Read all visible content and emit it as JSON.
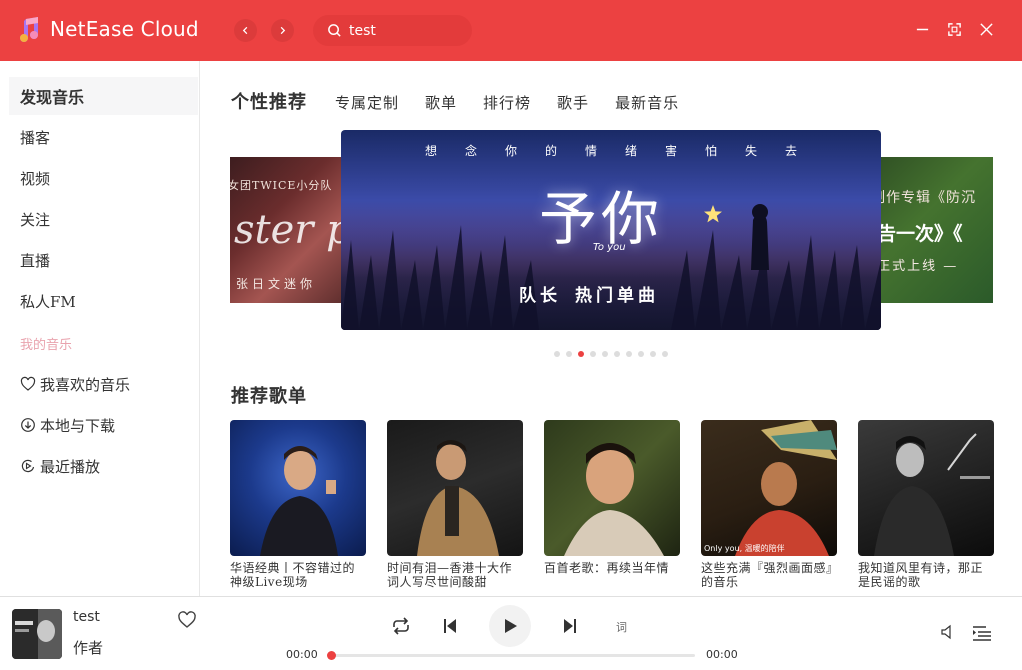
{
  "app": {
    "title": "NetEase Cloud",
    "brand_color": "#ec4141"
  },
  "search": {
    "value": "test"
  },
  "sidebar": {
    "items": [
      {
        "label": "发现音乐"
      },
      {
        "label": "播客"
      },
      {
        "label": "视频"
      },
      {
        "label": "关注"
      },
      {
        "label": "直播"
      },
      {
        "label": "私人FM"
      }
    ],
    "my_music_title": "我的音乐",
    "my_music": [
      {
        "label": "我喜欢的音乐",
        "icon": "heart-icon"
      },
      {
        "label": "本地与下载",
        "icon": "download-icon"
      },
      {
        "label": "最近播放",
        "icon": "recent-play-icon"
      }
    ]
  },
  "tabs": [
    "个性推荐",
    "专属定制",
    "歌单",
    "排行榜",
    "歌手",
    "最新音乐"
  ],
  "banner": {
    "left": {
      "top": "女团TWICE小分队",
      "script": "ster pie",
      "bottom": "张日文迷你"
    },
    "center": {
      "subline": "想念你的情绪害怕失去",
      "title": "予你",
      "title_en": "To you",
      "caption_a": "队长",
      "caption_b": "热门单曲"
    },
    "right": {
      "top": "全制作专辑《防沉",
      "mid": "警告一次》《",
      "bottom": "— 正式上线 —"
    },
    "dots_count": 10,
    "active_dot": 2
  },
  "recommend": {
    "title": "推荐歌单",
    "playlists": [
      {
        "name": "华语经典丨不容错过的神级Live现场"
      },
      {
        "name": "时间有泪—香港十大作词人写尽世间酸甜"
      },
      {
        "name": "百首老歌：再续当年情"
      },
      {
        "name": "这些充满『强烈画面感』的音乐",
        "cover_text": "Only you, 温暖的陪伴"
      },
      {
        "name": "我知道风里有诗，那正是民谣的歌"
      }
    ]
  },
  "player": {
    "song": "test",
    "artist": "作者",
    "lyric_label": "词",
    "time_current": "00:00",
    "time_total": "00:00",
    "progress": 0
  }
}
